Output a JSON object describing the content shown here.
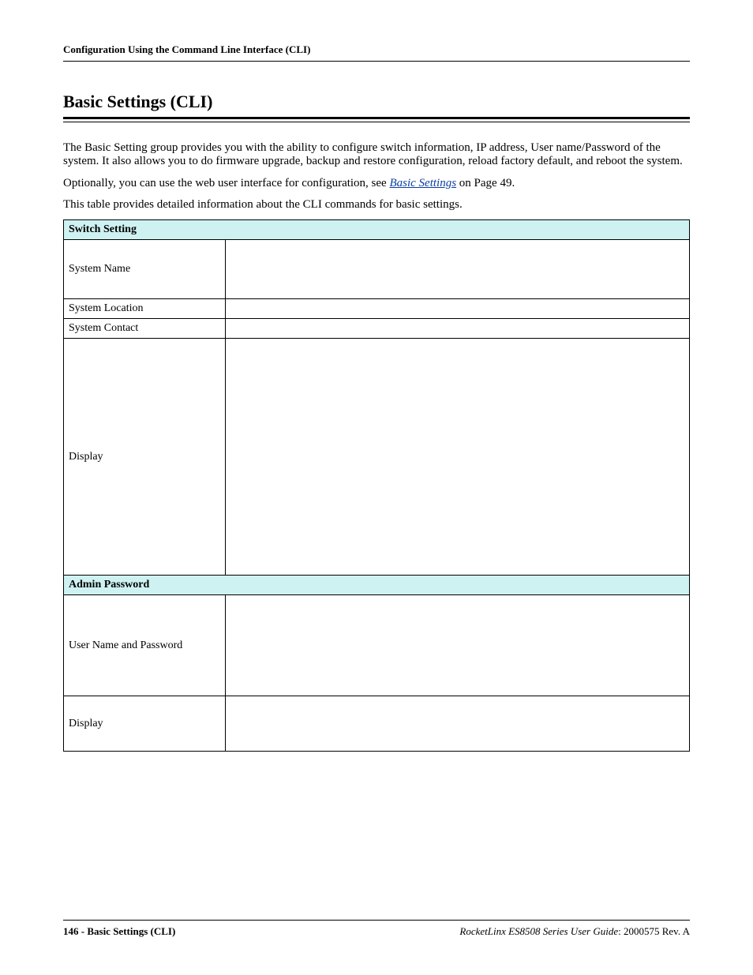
{
  "runningHead": "Configuration Using the Command Line Interface (CLI)",
  "title": "Basic Settings (CLI)",
  "para1": "The Basic Setting group provides you with the ability to configure switch information, IP address, User name/Password of the system. It also allows you to do firmware upgrade, backup and restore configuration, reload factory default, and reboot the system.",
  "para2a": "Optionally, you can use the web user interface for configuration, see ",
  "para2_link": "Basic Settings",
  "para2b": " on Page 49.",
  "para3": "This table provides detailed information about the CLI commands for basic settings.",
  "table": {
    "h1": "Switch Setting",
    "r1": "System Name",
    "r2": "System Location",
    "r3": "System Contact",
    "r4": "Display",
    "h2": "Admin Password",
    "r5": "User Name and Password",
    "r6": "Display"
  },
  "footer": {
    "page": "146",
    "sep": " - ",
    "section": "Basic Settings (CLI)",
    "product": "RocketLinx ES8508 Series  User Guide",
    "rev": ": 2000575 Rev. A"
  }
}
